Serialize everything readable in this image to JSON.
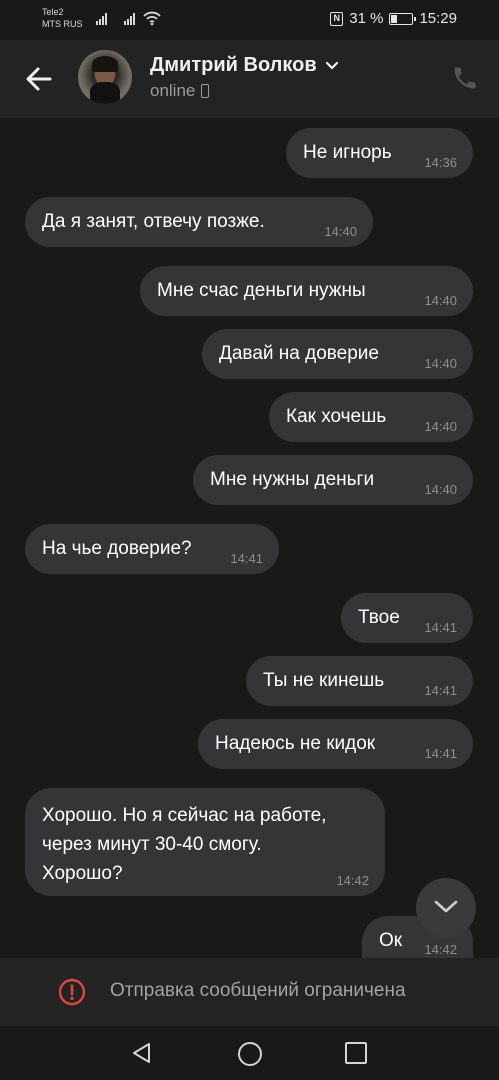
{
  "status_bar": {
    "carrier1": "Tele2",
    "carrier2": "MTS RUS",
    "battery": "31 %",
    "time": "15:29"
  },
  "header": {
    "contact_name": "Дмитрий Волков",
    "status": "online"
  },
  "messages": [
    {
      "side": "out",
      "text": "Не игнорь",
      "time": "14:36"
    },
    {
      "side": "in",
      "text": "Да я занят, отвечу позже.",
      "time": "14:40"
    },
    {
      "side": "out",
      "text": "Мне счас деньги нужны",
      "time": "14:40"
    },
    {
      "side": "out",
      "text": "Давай на доверие",
      "time": "14:40"
    },
    {
      "side": "out",
      "text": "Как хочешь",
      "time": "14:40"
    },
    {
      "side": "out",
      "text": "Мне нужны деньги",
      "time": "14:40"
    },
    {
      "side": "in",
      "text": "На чье доверие?",
      "time": "14:41"
    },
    {
      "side": "out",
      "text": "Твое",
      "time": "14:41"
    },
    {
      "side": "out",
      "text": "Ты не кинешь",
      "time": "14:41"
    },
    {
      "side": "out",
      "text": "Надеюсь не кидок",
      "time": "14:41"
    },
    {
      "side": "in",
      "lines": [
        "Хорошо. Но я сейчас на работе,",
        "через минут 30-40 смогу.",
        "Хорошо?"
      ],
      "time": "14:42"
    },
    {
      "side": "out",
      "text": "Ок",
      "time": "14:42"
    }
  ],
  "footer": {
    "restricted_text": "Отправка сообщений ограничена"
  },
  "colors": {
    "background": "#19191a",
    "bubble": "#353537",
    "header": "#232323",
    "warning": "#e04545"
  }
}
